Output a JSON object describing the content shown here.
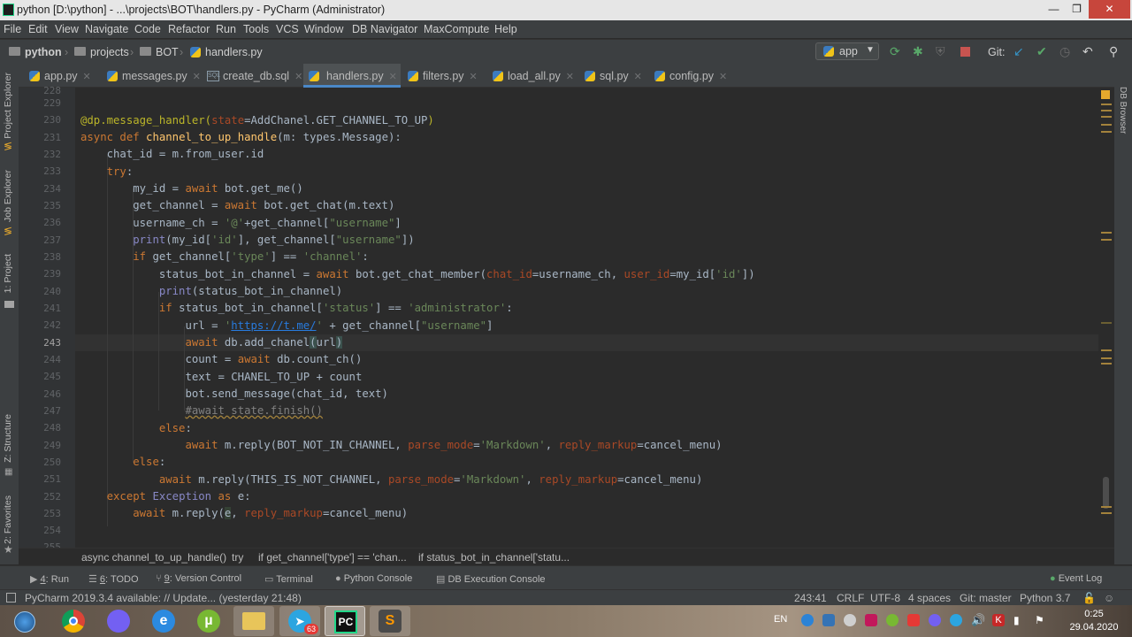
{
  "window": {
    "title": "python [D:\\python] - ...\\projects\\BOT\\handlers.py - PyCharm (Administrator)",
    "min": "—",
    "max": "❐",
    "close": "✕"
  },
  "menu": [
    "File",
    "Edit",
    "View",
    "Navigate",
    "Code",
    "Refactor",
    "Run",
    "Tools",
    "VCS",
    "Window",
    "DB Navigator",
    "MaxCompute",
    "Help"
  ],
  "breadcrumbs": [
    "python",
    "projects",
    "BOT",
    "handlers.py"
  ],
  "run_config": "app",
  "git_label": "Git:",
  "left_tools": [
    "Project Explorer",
    "Job Explorer",
    "1: Project",
    "Z: Structure",
    "2: Favorites"
  ],
  "right_tools": [
    "DB Browser"
  ],
  "tabs": [
    "app.py",
    "messages.py",
    "create_db.sql",
    "handlers.py",
    "filters.py",
    "load_all.py",
    "sql.py",
    "config.py"
  ],
  "editor": {
    "line_numbers": [
      "228",
      "229",
      "230",
      "231",
      "232",
      "233",
      "234",
      "235",
      "236",
      "237",
      "238",
      "239",
      "240",
      "241",
      "242",
      "243",
      "244",
      "245",
      "246",
      "247",
      "248",
      "249",
      "250",
      "251",
      "252",
      "253",
      "254",
      "255"
    ],
    "current_line": "243"
  },
  "code_breadcrumbs": [
    "async channel_to_up_handle()",
    "try",
    "if get_channel['type'] == 'chan...",
    "if status_bot_in_channel['statu..."
  ],
  "tool_windows": [
    {
      "key": "4",
      "label": "Run"
    },
    {
      "key": "6",
      "label": "TODO"
    },
    {
      "key": "9",
      "label": "Version Control"
    },
    {
      "key": "",
      "label": "Terminal"
    },
    {
      "key": "",
      "label": "Python Console"
    },
    {
      "key": "",
      "label": "DB Execution Console"
    }
  ],
  "event_log": "Event Log",
  "status": {
    "message": "PyCharm 2019.3.4 available: // Update... (yesterday 21:48)",
    "position": "243:41",
    "line_sep": "CRLF",
    "encoding": "UTF-8",
    "indent": "4 spaces",
    "git": "Git: master",
    "interpreter": "Python 3.7"
  },
  "taskbar": {
    "lang": "EN",
    "time": "0:25",
    "date": "29.04.2020",
    "badge": "63"
  }
}
